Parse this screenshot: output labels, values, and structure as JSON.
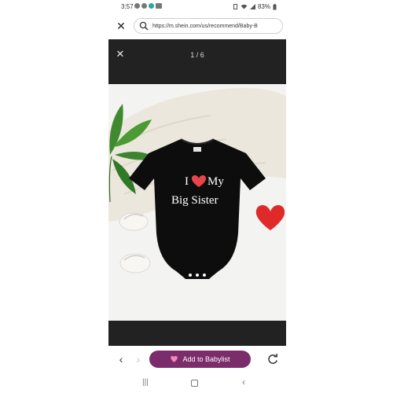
{
  "status_bar": {
    "time": "3:57",
    "battery": "83%"
  },
  "browser": {
    "url": "https://m.shein.com/us/recommend/Baby-B"
  },
  "viewer": {
    "counter": "1 / 6",
    "product_print": {
      "line1_left": "I",
      "line1_right": "My",
      "line2": "Big Sister"
    }
  },
  "bottom_bar": {
    "add_button_label": "Add to Babylist"
  },
  "colors": {
    "accent": "#7b2c6a",
    "heart": "#e8454a"
  },
  "icons": [
    "close-icon",
    "search-icon",
    "back-arrow-icon",
    "forward-arrow-icon",
    "heart-icon",
    "reload-icon"
  ]
}
